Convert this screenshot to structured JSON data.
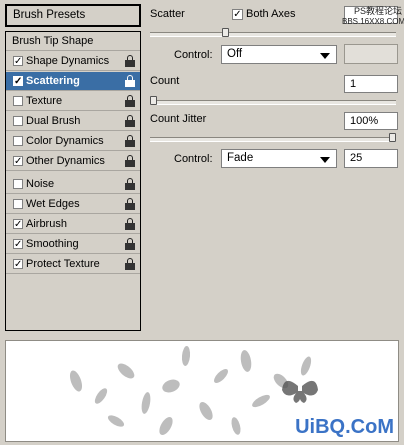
{
  "left_panel": {
    "presets_label": "Brush Presets",
    "tip_shape_label": "Brush Tip Shape",
    "items": [
      {
        "label": "Shape Dynamics",
        "checked": true,
        "selected": false
      },
      {
        "label": "Scattering",
        "checked": true,
        "selected": true
      },
      {
        "label": "Texture",
        "checked": false,
        "selected": false
      },
      {
        "label": "Dual Brush",
        "checked": false,
        "selected": false
      },
      {
        "label": "Color Dynamics",
        "checked": false,
        "selected": false
      },
      {
        "label": "Other Dynamics",
        "checked": true,
        "selected": false
      },
      {
        "label": "Noise",
        "checked": false,
        "selected": false
      },
      {
        "label": "Wet Edges",
        "checked": false,
        "selected": false
      },
      {
        "label": "Airbrush",
        "checked": true,
        "selected": false
      },
      {
        "label": "Smoothing",
        "checked": true,
        "selected": false
      },
      {
        "label": "Protect Texture",
        "checked": true,
        "selected": false
      }
    ]
  },
  "scattering": {
    "scatter_label": "Scatter",
    "both_axes_label": "Both Axes",
    "both_axes_checked": true,
    "scatter_value": "",
    "scatter_slider": 0.3,
    "control1_label": "Control:",
    "control1_value": "Off",
    "count_label": "Count",
    "count_value": "1",
    "count_slider": 0.0,
    "count_jitter_label": "Count Jitter",
    "count_jitter_value": "100%",
    "count_jitter_slider": 1.0,
    "control2_label": "Control:",
    "control2_value": "Fade",
    "fade_value": "25"
  },
  "watermark": {
    "top_text": "PS教程论坛",
    "top_sub": "BBS.16XX8.COM",
    "bottom_text": "UiBQ.CoM"
  },
  "colors": {
    "selected": "#3a6ea5",
    "panel": "#d4d0c8"
  }
}
